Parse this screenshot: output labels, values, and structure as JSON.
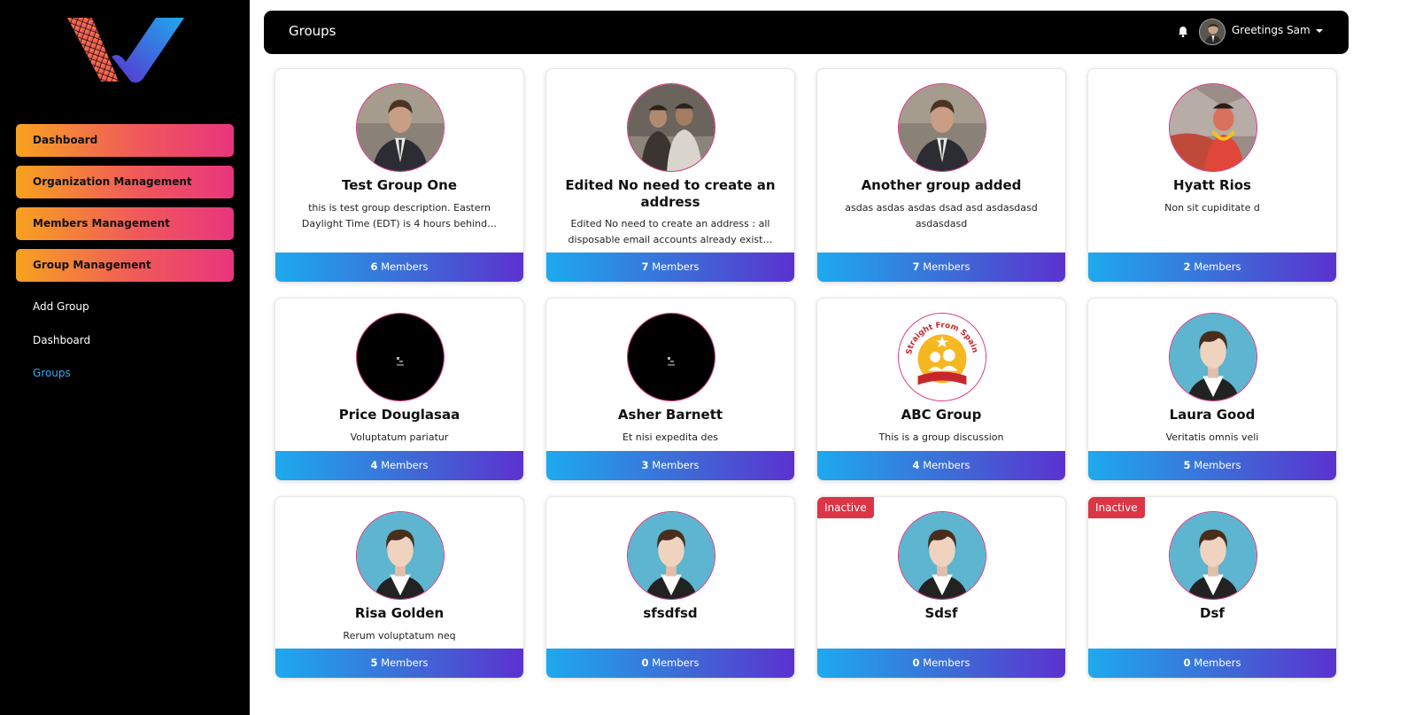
{
  "header": {
    "title": "Groups",
    "greeting": "Greetings Sam",
    "notification_icon": "bell-icon"
  },
  "sidebar": {
    "nav": [
      {
        "label": "Dashboard"
      },
      {
        "label": "Organization Management"
      },
      {
        "label": "Members Management"
      },
      {
        "label": "Group Management"
      }
    ],
    "sub": [
      {
        "label": "Add Group"
      },
      {
        "label": "Dashboard"
      },
      {
        "label": "Groups",
        "active": true
      }
    ]
  },
  "groups": [
    {
      "name": "Test Group One",
      "description": "this is test group description. Eastern Daylight Time (EDT) is 4 hours behind…",
      "members": "6",
      "members_label": "Members",
      "avatar": "man-suit-photo"
    },
    {
      "name": "Edited No need to create an address",
      "description": "Edited No need to create an address : all disposable email accounts already exist…",
      "members": "7",
      "members_label": "Members",
      "avatar": "two-men-photo"
    },
    {
      "name": "Another group added",
      "description": "asdas asdas asdas dsad asd asdasdasd asdasdasd",
      "members": "7",
      "members_label": "Members",
      "avatar": "man-suit-photo"
    },
    {
      "name": "Hyatt Rios",
      "description": "Non sit cupiditate d",
      "members": "2",
      "members_label": "Members",
      "avatar": "festival-photo"
    },
    {
      "name": "Price Douglasaa",
      "description": "Voluptatum pariatur",
      "members": "4",
      "members_label": "Members",
      "avatar": "dark-image"
    },
    {
      "name": "Asher Barnett",
      "description": "Et nisi expedita des",
      "members": "3",
      "members_label": "Members",
      "avatar": "dark-image"
    },
    {
      "name": "ABC Group",
      "description": "This is a group discussion",
      "members": "4",
      "members_label": "Members",
      "avatar": "academy-logo",
      "logo_text": "Straight From Spain Academy"
    },
    {
      "name": "Laura Good",
      "description": "Veritatis omnis veli",
      "members": "5",
      "members_label": "Members",
      "avatar": "default-avatar"
    },
    {
      "name": "Risa Golden",
      "description": "Rerum voluptatum neq",
      "members": "5",
      "members_label": "Members",
      "avatar": "default-avatar"
    },
    {
      "name": "sfsdfsd",
      "description": "",
      "members": "0",
      "members_label": "Members",
      "avatar": "default-avatar"
    },
    {
      "name": "Sdsf",
      "description": "",
      "members": "0",
      "members_label": "Members",
      "avatar": "default-avatar",
      "badge": "Inactive"
    },
    {
      "name": "Dsf",
      "description": "",
      "members": "0",
      "members_label": "Members",
      "avatar": "default-avatar",
      "badge": "Inactive"
    }
  ],
  "colors": {
    "sidebar_bg": "#000000",
    "nav_gradient_start": "#f7a21f",
    "nav_gradient_end": "#e8357d",
    "footer_gradient_start": "#1ea9ee",
    "footer_gradient_end": "#5b32cf",
    "inactive_badge": "#dc3545",
    "active_link": "#33a9f0",
    "avatar_ring": "#d63384"
  }
}
